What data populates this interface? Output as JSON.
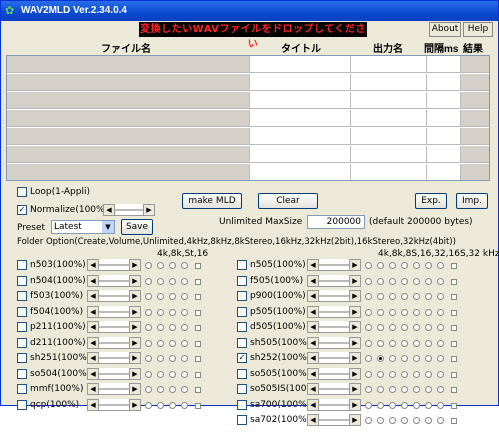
{
  "window": {
    "title": "WAV2MLD Ver.2.34.0.4",
    "icon": "frog-icon"
  },
  "banner": "変換したいWAVファイルをドロップしてください",
  "menu": {
    "about": "About",
    "help": "Help"
  },
  "table": {
    "columns": [
      "ファイル名",
      "タイトル",
      "出力名",
      "間隔ms",
      "結果"
    ],
    "row_count": 7
  },
  "controls": {
    "loop_label": "Loop(1-Appli)",
    "loop_checked": false,
    "normalize_label": "Normalize(100%)",
    "normalize_checked": true,
    "make_mld": "make MLD",
    "clear": "Clear",
    "exp": "Exp.",
    "imp": "Imp.",
    "preset_label": "Preset",
    "preset_value": "Latest",
    "save": "Save",
    "maxsize_label": "Unlimited MaxSize",
    "maxsize_value": "200000",
    "maxsize_default": "(default 200000 bytes)",
    "folder_option": "Folder Option(Create,Volume,Unlimited,4kHz,8kHz,8kStereo,16kHz,32kHz(2bit),16kStereo,32kHz(4bit))",
    "left_group_header": "4k,8k,St,16",
    "right_group_header": "4k,8k,8S,16,32,16S,32 kHz"
  },
  "left_models": [
    {
      "label": "n503(100%)",
      "checked": false
    },
    {
      "label": "n504(100%)",
      "checked": false
    },
    {
      "label": "f503(100%)",
      "checked": false
    },
    {
      "label": "f504(100%)",
      "checked": false
    },
    {
      "label": "p211(100%)",
      "checked": false
    },
    {
      "label": "d211(100%)",
      "checked": false
    },
    {
      "label": "sh251(100%)",
      "checked": false
    },
    {
      "label": "so504(100%)",
      "checked": false
    },
    {
      "label": "mmf(100%)",
      "checked": false
    },
    {
      "label": "qcp(100%)",
      "checked": false
    }
  ],
  "right_models": [
    {
      "label": "n505(100%)",
      "checked": false
    },
    {
      "label": "f505(100%)",
      "checked": false
    },
    {
      "label": "p900(100%)",
      "checked": false
    },
    {
      "label": "p505(100%)",
      "checked": false
    },
    {
      "label": "d505(100%)",
      "checked": false
    },
    {
      "label": "sh505(100%)",
      "checked": false
    },
    {
      "label": "sh252(100%)",
      "checked": true
    },
    {
      "label": "so505(100%)",
      "checked": false
    },
    {
      "label": "so505IS(100%)",
      "checked": false
    },
    {
      "label": "sa700(100%)",
      "checked": false
    },
    {
      "label": "sa702(100%)",
      "checked": false
    }
  ]
}
